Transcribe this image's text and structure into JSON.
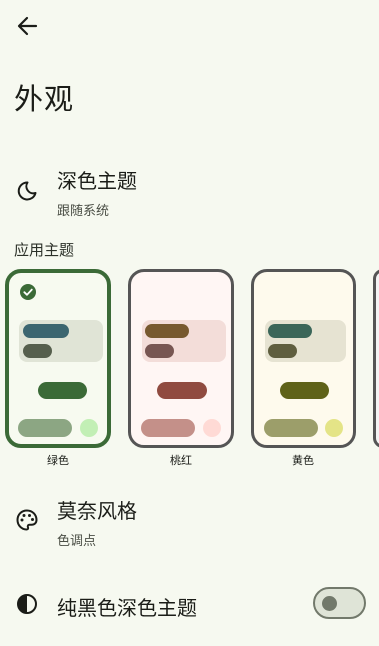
{
  "header": {
    "back_icon": "arrow-back-icon",
    "title": "外观"
  },
  "dark_theme": {
    "icon": "moon-icon",
    "title": "深色主题",
    "subtitle": "跟随系统"
  },
  "app_theme": {
    "section_title": "应用主题",
    "themes": [
      {
        "label": "绿色",
        "selected": true
      },
      {
        "label": "桃红",
        "selected": false
      },
      {
        "label": "黄色",
        "selected": false
      }
    ]
  },
  "monet": {
    "icon": "palette-icon",
    "title": "莫奈风格",
    "subtitle": "色调点"
  },
  "pure_black": {
    "icon": "contrast-icon",
    "title": "纯黑色深色主题",
    "toggle_on": false
  }
}
